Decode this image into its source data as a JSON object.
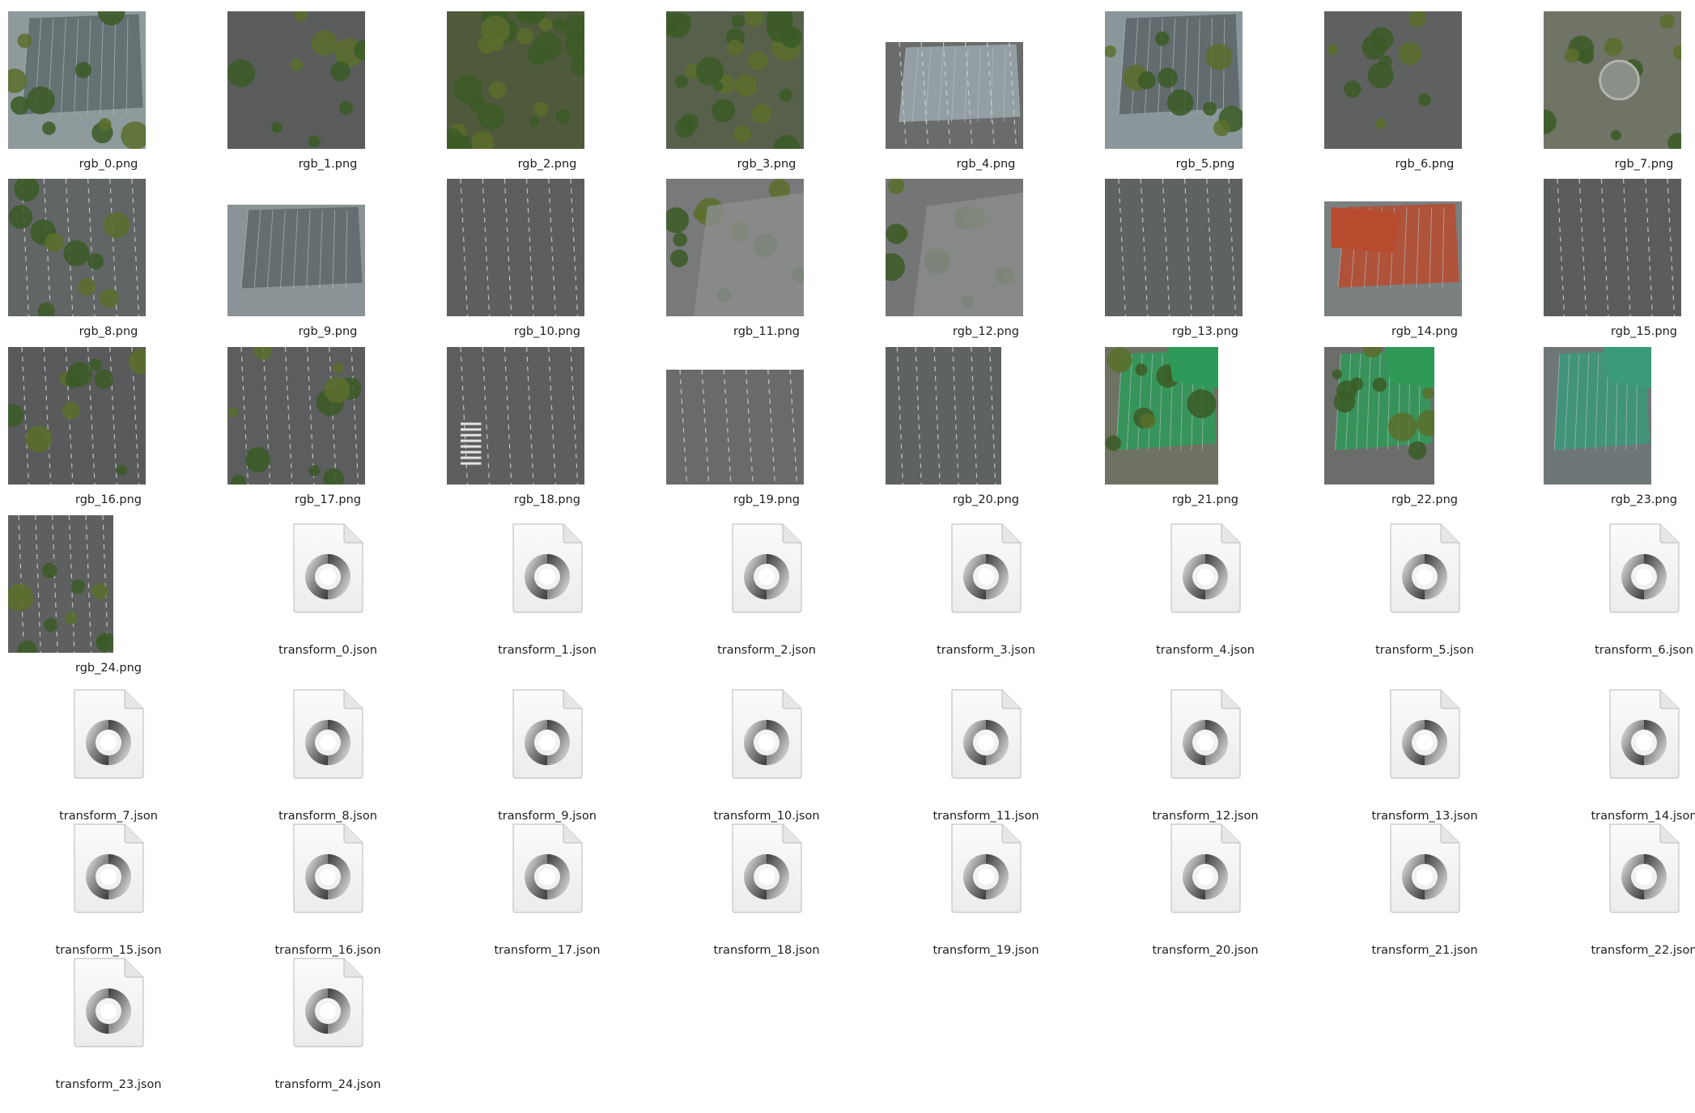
{
  "files": [
    {
      "name": "rgb_0.png",
      "kind": "image",
      "scene": "greenhouse-roof",
      "base": "#8e9a9c",
      "accent": "#5e6b6c"
    },
    {
      "name": "rgb_1.png",
      "kind": "image",
      "scene": "lot-with-trees",
      "base": "#5a5c5c",
      "accent": "#3f5a2c"
    },
    {
      "name": "rgb_2.png",
      "kind": "image",
      "scene": "park-trees",
      "base": "#4e5a3b",
      "accent": "#2f4a22"
    },
    {
      "name": "rgb_3.png",
      "kind": "image",
      "scene": "park-trees",
      "base": "#56604a",
      "accent": "#3d6a2c"
    },
    {
      "name": "rgb_4.png",
      "kind": "image",
      "scene": "road-roof",
      "base": "#6a6c6c",
      "accent": "#9aa8ac"
    },
    {
      "name": "rgb_5.png",
      "kind": "image",
      "scene": "greenhouse-roof",
      "base": "#8a979a",
      "accent": "#5a6466"
    },
    {
      "name": "rgb_6.png",
      "kind": "image",
      "scene": "lot-with-trees",
      "base": "#5e6160",
      "accent": "#41542f"
    },
    {
      "name": "rgb_7.png",
      "kind": "image",
      "scene": "fountain-square",
      "base": "#6f7466",
      "accent": "#4a5a30"
    },
    {
      "name": "rgb_8.png",
      "kind": "image",
      "scene": "street-trees",
      "base": "#626565",
      "accent": "#3c522a"
    },
    {
      "name": "rgb_9.png",
      "kind": "image",
      "scene": "grey-roofs",
      "base": "#8b9396",
      "accent": "#5d6668"
    },
    {
      "name": "rgb_10.png",
      "kind": "image",
      "scene": "avenue",
      "base": "#5c5e5f",
      "accent": "#4a7a2e"
    },
    {
      "name": "rgb_11.png",
      "kind": "image",
      "scene": "plaza",
      "base": "#77797a",
      "accent": "#4f7a34"
    },
    {
      "name": "rgb_12.png",
      "kind": "image",
      "scene": "plaza",
      "base": "#737576",
      "accent": "#4b7a33"
    },
    {
      "name": "rgb_13.png",
      "kind": "image",
      "scene": "road-markings",
      "base": "#5f6263",
      "accent": "#8c9a9f"
    },
    {
      "name": "rgb_14.png",
      "kind": "image",
      "scene": "red-roof",
      "base": "#7a7f80",
      "accent": "#b84a2e"
    },
    {
      "name": "rgb_15.png",
      "kind": "image",
      "scene": "avenue",
      "base": "#5a5c5d",
      "accent": "#c9b24a"
    },
    {
      "name": "rgb_16.png",
      "kind": "image",
      "scene": "avenue-green",
      "base": "#585a5b",
      "accent": "#5a7a32"
    },
    {
      "name": "rgb_17.png",
      "kind": "image",
      "scene": "avenue-green",
      "base": "#5b5d5e",
      "accent": "#5c8034"
    },
    {
      "name": "rgb_18.png",
      "kind": "image",
      "scene": "crosswalk",
      "base": "#5c5e5f",
      "accent": "#c8c8c8"
    },
    {
      "name": "rgb_19.png",
      "kind": "image",
      "scene": "buildings-road",
      "base": "#6a6a6a",
      "accent": "#8a5a4a"
    },
    {
      "name": "rgb_20.png",
      "kind": "image",
      "scene": "buildings-road",
      "base": "#5e6263",
      "accent": "#8a9296"
    },
    {
      "name": "rgb_21.png",
      "kind": "image",
      "scene": "green-roof",
      "base": "#6e7262",
      "accent": "#2e9a5a"
    },
    {
      "name": "rgb_22.png",
      "kind": "image",
      "scene": "green-roof",
      "base": "#6a6d6a",
      "accent": "#2f9a58"
    },
    {
      "name": "rgb_23.png",
      "kind": "image",
      "scene": "teal-roof",
      "base": "#6f7677",
      "accent": "#3a9a7a"
    },
    {
      "name": "rgb_24.png",
      "kind": "image",
      "scene": "street-trees",
      "base": "#5d605f",
      "accent": "#4a6a2a"
    },
    {
      "name": "transform_0.json",
      "kind": "json"
    },
    {
      "name": "transform_1.json",
      "kind": "json"
    },
    {
      "name": "transform_2.json",
      "kind": "json"
    },
    {
      "name": "transform_3.json",
      "kind": "json"
    },
    {
      "name": "transform_4.json",
      "kind": "json"
    },
    {
      "name": "transform_5.json",
      "kind": "json"
    },
    {
      "name": "transform_6.json",
      "kind": "json"
    },
    {
      "name": "transform_7.json",
      "kind": "json"
    },
    {
      "name": "transform_8.json",
      "kind": "json"
    },
    {
      "name": "transform_9.json",
      "kind": "json"
    },
    {
      "name": "transform_10.json",
      "kind": "json"
    },
    {
      "name": "transform_11.json",
      "kind": "json"
    },
    {
      "name": "transform_12.json",
      "kind": "json"
    },
    {
      "name": "transform_13.json",
      "kind": "json"
    },
    {
      "name": "transform_14.json",
      "kind": "json"
    },
    {
      "name": "transform_15.json",
      "kind": "json"
    },
    {
      "name": "transform_16.json",
      "kind": "json"
    },
    {
      "name": "transform_17.json",
      "kind": "json"
    },
    {
      "name": "transform_18.json",
      "kind": "json"
    },
    {
      "name": "transform_19.json",
      "kind": "json"
    },
    {
      "name": "transform_20.json",
      "kind": "json"
    },
    {
      "name": "transform_21.json",
      "kind": "json"
    },
    {
      "name": "transform_22.json",
      "kind": "json"
    },
    {
      "name": "transform_23.json",
      "kind": "json"
    },
    {
      "name": "transform_24.json",
      "kind": "json"
    }
  ],
  "icons": {
    "json_file": "json-file-icon"
  }
}
